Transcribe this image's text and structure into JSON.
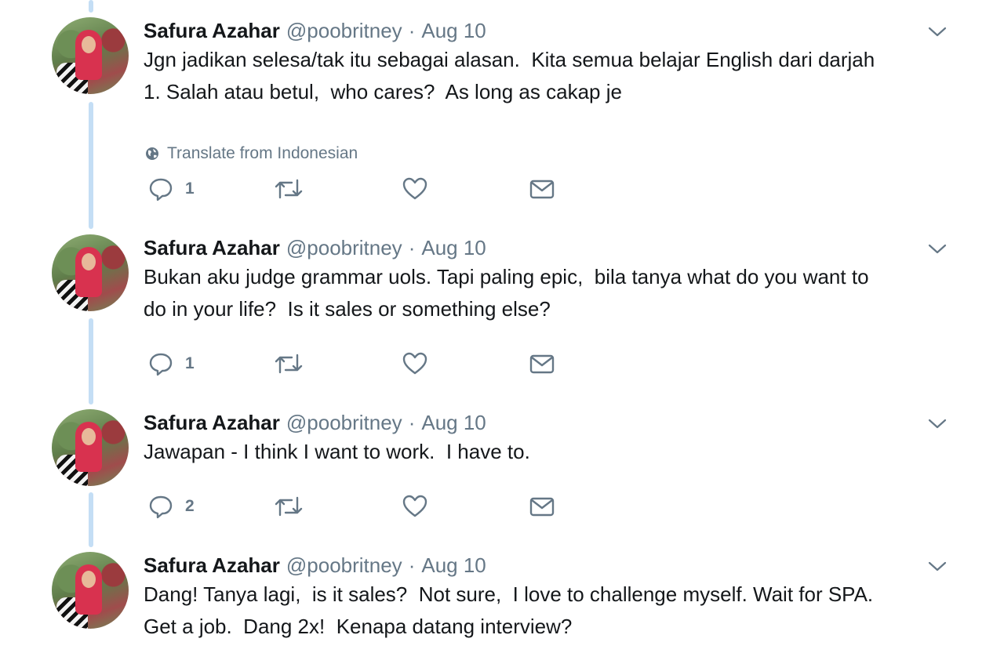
{
  "tweets": [
    {
      "name": "Safura Azahar",
      "handle": "@poobritney",
      "sep": "·",
      "date": "Aug 10",
      "text": "Jgn jadikan selesa/tak itu sebagai alasan.  Kita semua belajar English dari darjah\n1. Salah atau betul,  who cares?  As long as cakap je",
      "translate": "Translate from Indonesian",
      "reply_count": "1"
    },
    {
      "name": "Safura Azahar",
      "handle": "@poobritney",
      "sep": "·",
      "date": "Aug 10",
      "text": "Bukan aku judge grammar uols. Tapi paling epic,  bila tanya what do you want to\ndo in your life?  Is it sales or something else?",
      "reply_count": "1"
    },
    {
      "name": "Safura Azahar",
      "handle": "@poobritney",
      "sep": "·",
      "date": "Aug 10",
      "text": "Jawapan - I think I want to work.  I have to.",
      "reply_count": "2"
    },
    {
      "name": "Safura Azahar",
      "handle": "@poobritney",
      "sep": "·",
      "date": "Aug 10",
      "text": "Dang! Tanya lagi,  is it sales?  Not sure,  I love to challenge myself. Wait for SPA.\nGet a job.  Dang 2x!  Kenapa datang interview?"
    }
  ],
  "colors": {
    "thread_line": "#c4def5",
    "icon": "#657786",
    "text": "#14171a",
    "secondary": "#657786"
  },
  "icons": [
    "reply-icon",
    "retweet-icon",
    "like-icon",
    "dm-icon",
    "caret-down-icon",
    "globe-icon"
  ]
}
